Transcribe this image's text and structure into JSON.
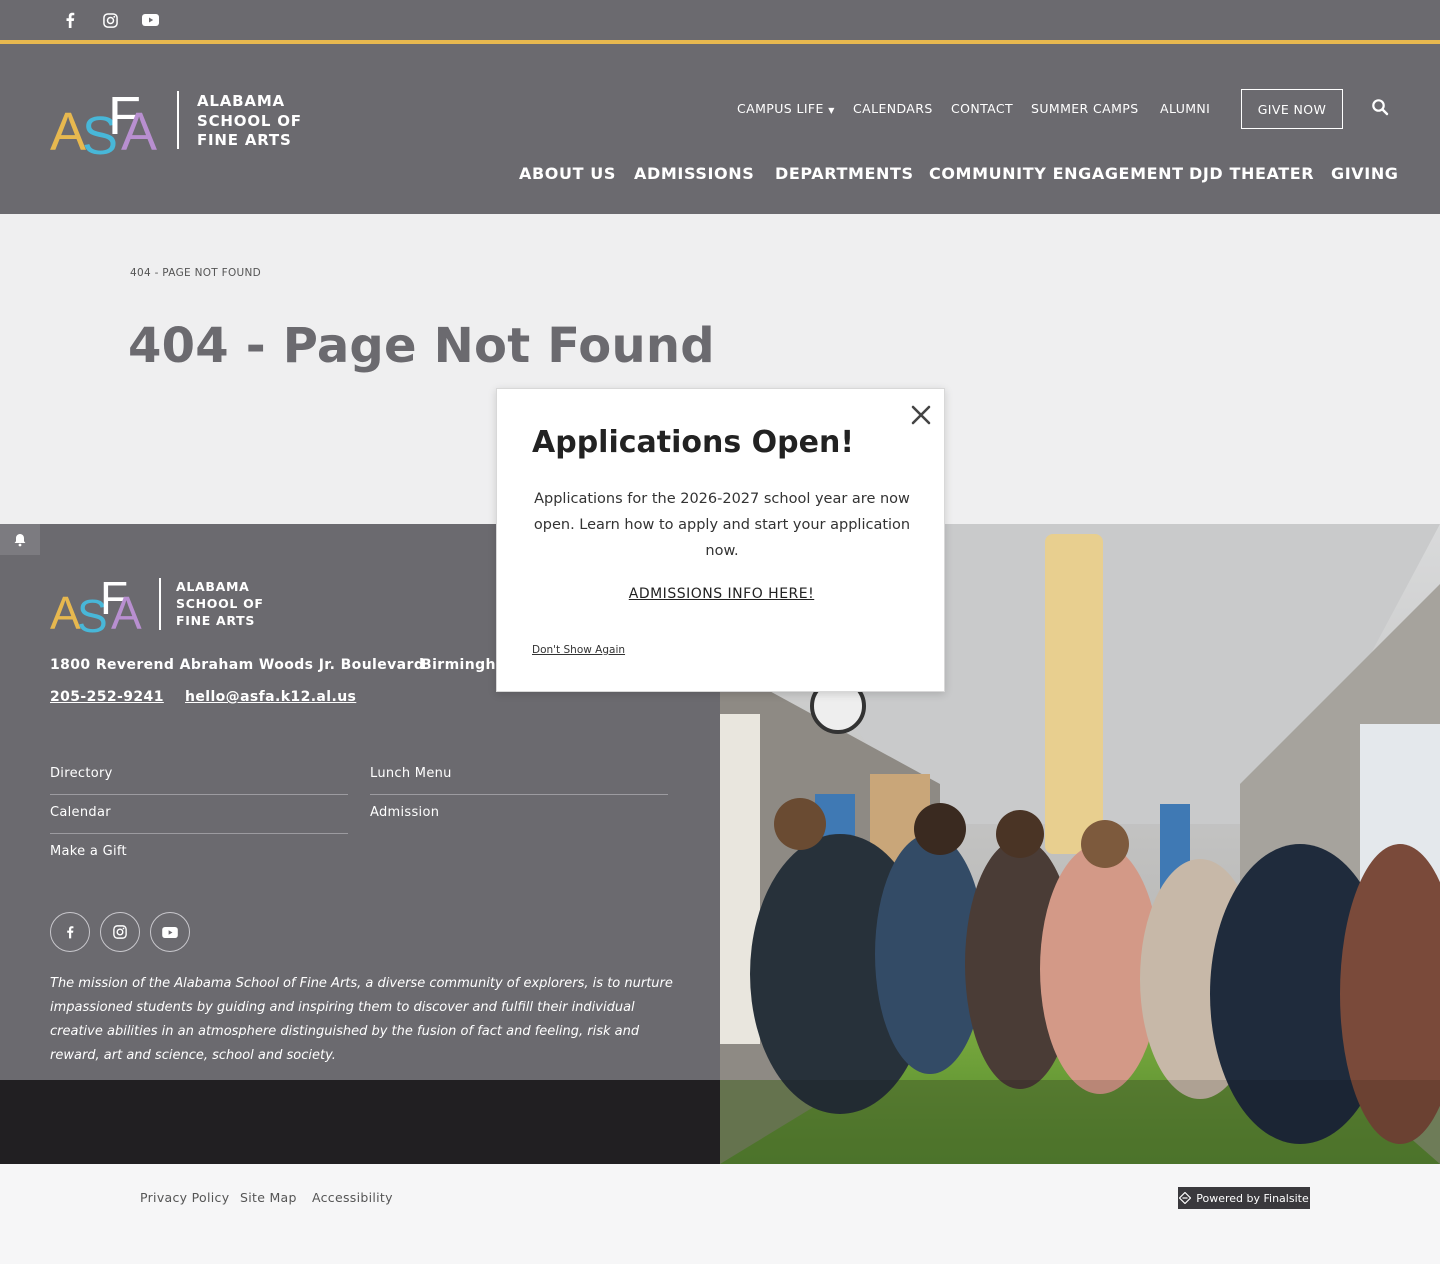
{
  "colors": {
    "header_bg": "#6b6a6f",
    "gold": "#e7b84f",
    "dark": "#211f22"
  },
  "social": [
    "facebook-icon",
    "instagram-icon",
    "youtube-icon"
  ],
  "logo": {
    "letters": "ASFA",
    "lines": [
      "ALABAMA",
      "SCHOOL OF",
      "FINE ARTS"
    ]
  },
  "utility_nav": {
    "items": [
      "CAMPUS LIFE",
      "CALENDARS",
      "CONTACT",
      "SUMMER CAMPS",
      "ALUMNI"
    ],
    "give": "GIVE NOW"
  },
  "main_nav": [
    "ABOUT US",
    "ADMISSIONS",
    "DEPARTMENTS",
    "COMMUNITY ENGAGEMENT",
    "DJD THEATER",
    "GIVING"
  ],
  "page": {
    "breadcrumb": "404 - PAGE NOT FOUND",
    "title": "404 - Page Not Found"
  },
  "modal": {
    "title": "Applications Open!",
    "body": "Applications for the 2026-2027 school year are now open. Learn how to apply and start your application now.",
    "link": "ADMISSIONS INFO HERE!",
    "dont_show": "Don't Show Again"
  },
  "footer": {
    "address": "1800 Reverend Abraham Woods Jr. Boulevard",
    "city": "Birmingha",
    "phone": "205-252-9241",
    "email": "hello@asfa.k12.al.us",
    "links_left": [
      "Directory",
      "Calendar",
      "Make a Gift"
    ],
    "links_right": [
      "Lunch Menu",
      "Admission"
    ],
    "mission": "The mission of the Alabama School of Fine Arts, a diverse community of explorers, is to nurture impassioned students by guiding and inspiring them to discover and fulfill their individual creative abilities in an atmosphere distinguished by the fusion of fact and feeling, risk and reward, art and science, school and society."
  },
  "bottom": {
    "links": [
      "Privacy Policy",
      "Site Map",
      "Accessibility"
    ],
    "powered": "Powered by Finalsite"
  }
}
